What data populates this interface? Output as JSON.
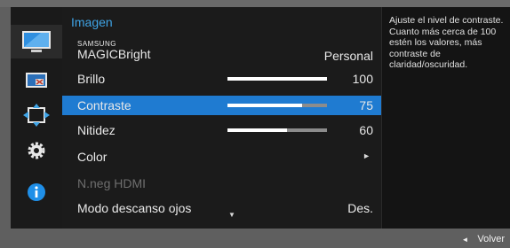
{
  "menu": {
    "title": "Imagen",
    "magic_bright": {
      "brand_small": "SAMSUNG",
      "brand_big": "MAGIC",
      "label_suffix": "Bright",
      "value": "Personal"
    },
    "brightness": {
      "label": "Brillo",
      "value": "100",
      "level": 1.0
    },
    "contrast": {
      "label": "Contraste",
      "value": "75",
      "level": 0.75
    },
    "sharpness": {
      "label": "Nitidez",
      "value": "60",
      "level": 0.6
    },
    "color": {
      "label": "Color",
      "arrow": "►"
    },
    "hdmi_black": {
      "label": "N.neg HDMI"
    },
    "eye_saver": {
      "label": "Modo descanso ojos",
      "value": "Des."
    },
    "scroll_indicator": "▼"
  },
  "help": {
    "text": "Ajuste el nivel de contraste. Cuanto más cerca de 100 estén los valores, más contraste de claridad/oscuridad."
  },
  "footer": {
    "back_arrow": "◄",
    "back_label": "Volver"
  },
  "icons": [
    "picture-icon",
    "screen-size-icon",
    "position-icon",
    "settings-gear-icon",
    "info-icon"
  ],
  "colors": {
    "accent": "#3fa4e6",
    "selected_row": "#1f7bd1"
  }
}
